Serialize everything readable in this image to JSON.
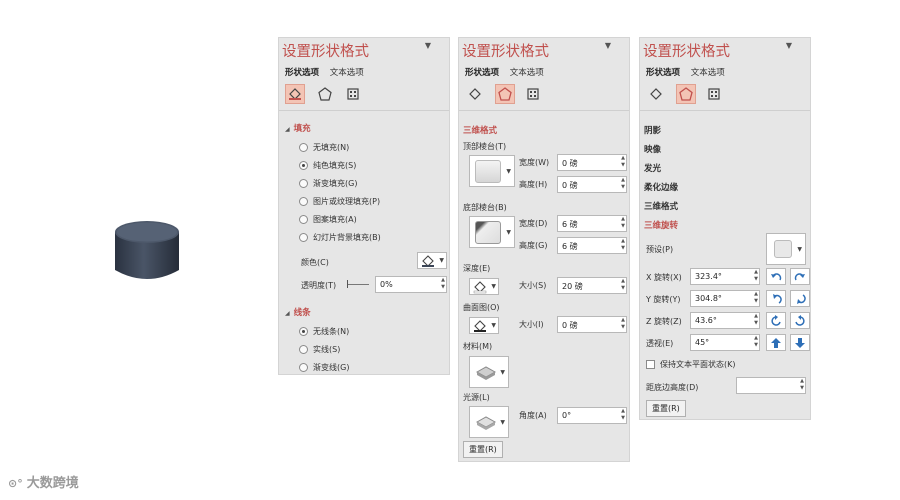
{
  "panel1": {
    "title": "设置形状格式",
    "tab_shape": "形状选项",
    "tab_text": "文本选项",
    "fill_section": "填充",
    "fill_options": [
      "无填充(N)",
      "纯色填充(S)",
      "渐变填充(G)",
      "图片或纹理填充(P)",
      "图案填充(A)",
      "幻灯片背景填充(B)"
    ],
    "color_label": "颜色(C)",
    "transparency_label": "透明度(T)",
    "transparency_value": "0%",
    "line_section": "线条",
    "line_options": [
      "无线条(N)",
      "实线(S)",
      "渐变线(G)"
    ]
  },
  "panel2": {
    "title": "设置形状格式",
    "tab_shape": "形状选项",
    "tab_text": "文本选项",
    "section": "三维格式",
    "top_bevel": "顶部棱台(T)",
    "width_label": "宽度(W)",
    "height_label": "高度(H)",
    "top_width": "0 磅",
    "top_height": "0 磅",
    "bottom_bevel": "底部棱台(B)",
    "bottom_width_label": "宽度(D)",
    "bottom_height_label": "高度(G)",
    "bottom_width": "6 磅",
    "bottom_height": "6 磅",
    "depth_label": "深度(E)",
    "depth_size_label": "大小(S)",
    "depth_size": "20 磅",
    "contour_label": "曲面图(O)",
    "contour_size_label": "大小(I)",
    "contour_size": "0 磅",
    "material_label": "材料(M)",
    "lighting_label": "光源(L)",
    "angle_label": "角度(A)",
    "angle_value": "0°",
    "reset_label": "重置(R)"
  },
  "panel3": {
    "title": "设置形状格式",
    "tab_shape": "形状选项",
    "tab_text": "文本选项",
    "sections": [
      "阴影",
      "映像",
      "发光",
      "柔化边缘",
      "三维格式"
    ],
    "active_section": "三维旋转",
    "presets_label": "预设(P)",
    "x_label": "X 旋转(X)",
    "x_value": "323.4°",
    "y_label": "Y 旋转(Y)",
    "y_value": "304.8°",
    "z_label": "Z 旋转(Z)",
    "z_value": "43.6°",
    "perspective_label": "透视(E)",
    "perspective_value": "45°",
    "keep_text_flat": "保持文本平面状态(K)",
    "distance_label": "距底边高度(D)",
    "reset_label": "重置(R)"
  },
  "watermark": "大数跨境",
  "colors": {
    "accent": "#c0504d",
    "panel_bg": "#e6e6e6",
    "cylinder": "#3b4556"
  }
}
